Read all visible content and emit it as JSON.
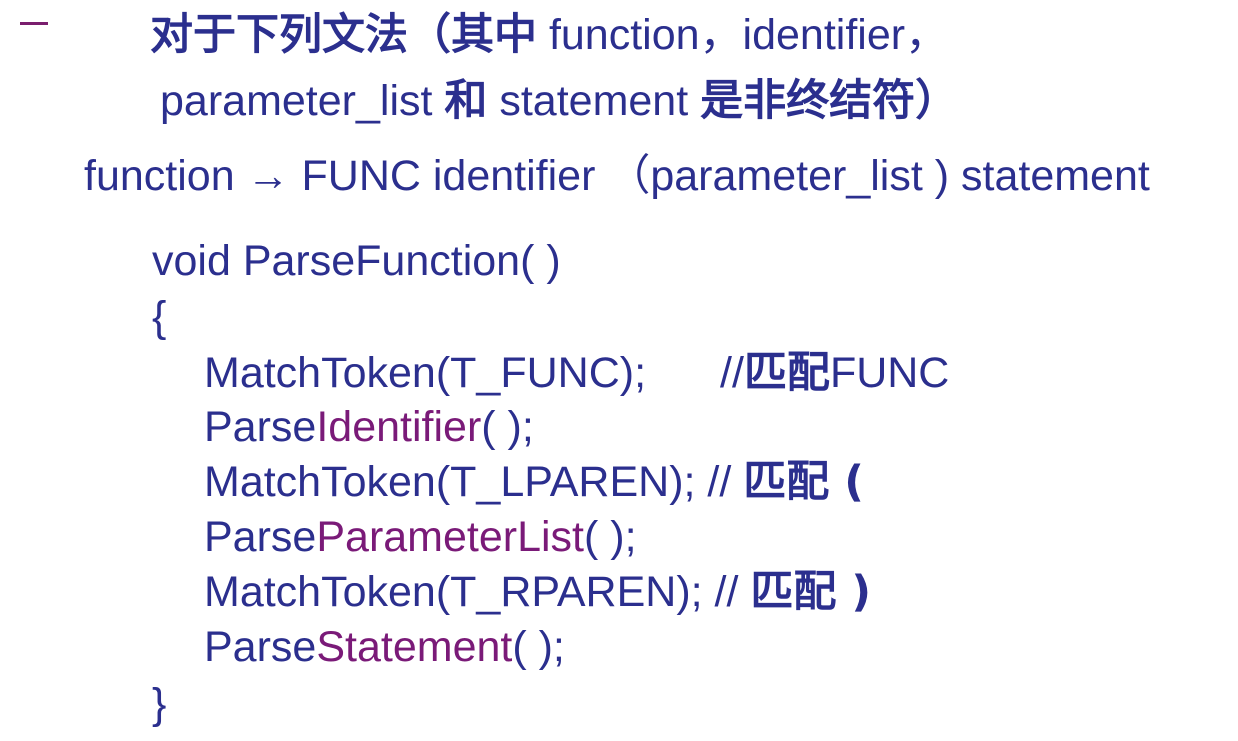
{
  "heading": {
    "line1": {
      "cjk_a": "对于下列文法",
      "cjk_b": "（其中",
      "latin": " function，identifier，"
    },
    "line2": {
      "latin_a": "parameter_list ",
      "cjk_a": "和",
      "latin_b": " statement ",
      "cjk_b": "是非终结符）"
    }
  },
  "grammar_rule": "function → FUNC identifier （parameter_list ) statement",
  "code": {
    "signature": "void ParseFunction( )",
    "open_brace": "{",
    "close_brace": "}",
    "lines": [
      {
        "pre": "MatchToken(T_FUNC);",
        "comment_prefix": "//",
        "comment_cjk": "匹配",
        "comment_suffix": "FUNC"
      },
      {
        "pre": "Parse",
        "call": "Identifier",
        "post": "( );"
      },
      {
        "pre": "MatchToken(T_LPAREN);  // ",
        "comment_cjk": "匹配",
        "comment_suffix": "  ("
      },
      {
        "pre": "Parse",
        "call": "ParameterList",
        "post": "( );"
      },
      {
        "pre": "MatchToken(T_RPAREN);  // ",
        "comment_cjk": "匹配",
        "comment_suffix": " )"
      },
      {
        "pre": "Parse",
        "call": "Statement",
        "post": "( );"
      }
    ]
  },
  "colors": {
    "text": "#2b2f8e",
    "call_highlight": "#7a1a78",
    "bullet": "#7a1e6e"
  }
}
